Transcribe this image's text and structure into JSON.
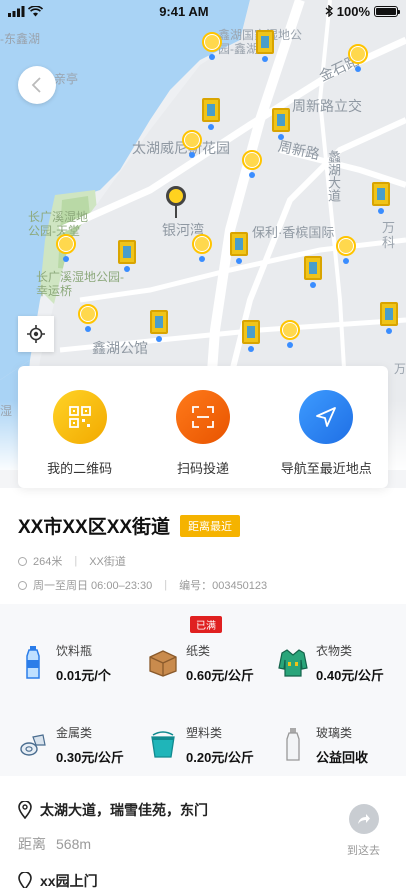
{
  "status_bar": {
    "time": "9:41 AM",
    "battery": "100%"
  },
  "map_labels": {
    "wetland_park": "鑫湖国家湿地公园-鑫湖",
    "east_lake": "-东鑫湖",
    "jinshi": "金石路",
    "pavilion": "亲亭",
    "zhouxin_road": "周新路立交",
    "taihu_garden": "太湖威尼斯花园",
    "zhouxin": "周新路",
    "zhenhu_avenue": "蠡湖大道",
    "silver_river": "银河湾",
    "poly": "保利·香槟国际",
    "wanke": "万科",
    "changguang_heaven": "长广溪湿地公园-天堂",
    "changguang_lucky": "长广溪湿地公园-幸运桥",
    "xinhu_hall": "鑫湖公馆",
    "wan": "万",
    "wetland": "湿"
  },
  "actions": [
    {
      "label": "我的二维码",
      "icon": "qr-code-icon"
    },
    {
      "label": "扫码投递",
      "icon": "scan-icon"
    },
    {
      "label": "导航至最近地点",
      "icon": "navigation-icon"
    }
  ],
  "station": {
    "title": "XX市XX区XX街道",
    "tag": "距离最近",
    "distance": "264米",
    "street": "XX街道",
    "hours": "周一至周日 06:00–23:30",
    "number": "编号：003450123"
  },
  "prices": [
    {
      "name": "饮料瓶",
      "value": "0.01元/个",
      "icon": "bottle-icon",
      "badge": ""
    },
    {
      "name": "纸类",
      "value": "0.60元/公斤",
      "icon": "box-icon",
      "badge": "已满"
    },
    {
      "name": "衣物类",
      "value": "0.40元/公斤",
      "icon": "clothes-icon",
      "badge": ""
    },
    {
      "name": "金属类",
      "value": "0.30元/公斤",
      "icon": "metal-can-icon",
      "badge": ""
    },
    {
      "name": "塑料类",
      "value": "0.20元/公斤",
      "icon": "plastic-bucket-icon",
      "badge": ""
    },
    {
      "name": "玻璃类",
      "value": "公益回收",
      "icon": "glass-bottle-icon",
      "badge": ""
    }
  ],
  "address": {
    "text": "太湖大道，瑞雪佳苑，东门",
    "distance_label": "距离",
    "distance_value": "568m",
    "go_label": "到这去"
  },
  "next_address": {
    "text": "xx园上门"
  },
  "colors": {
    "accent": "#f5b300",
    "orange": "#e85400",
    "blue": "#1f6fe5",
    "full": "#e02020"
  }
}
